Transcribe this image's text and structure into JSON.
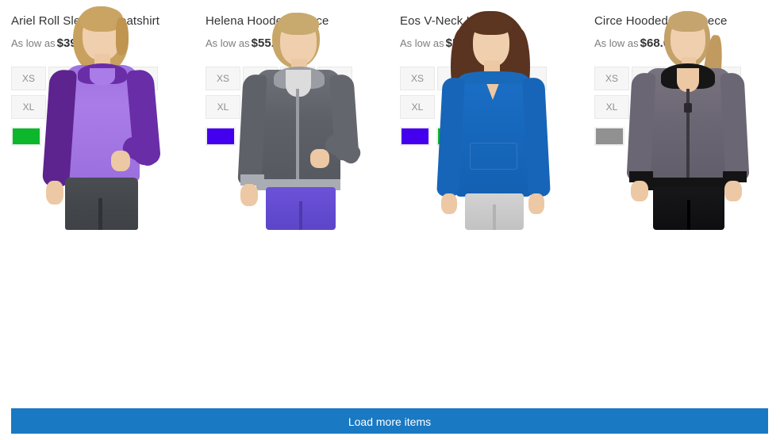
{
  "products": [
    {
      "name": "Ariel Roll Sleeve Sweatshirt",
      "price_prefix": "As low as",
      "price": "$39.00",
      "sizes": [
        "XS",
        "S",
        "M",
        "L",
        "XL"
      ],
      "colors": [
        {
          "name": "green-swatch",
          "hex": "#0CB72B"
        },
        {
          "name": "magenta-swatch",
          "hex": "#FF00FF"
        },
        {
          "name": "red-swatch",
          "hex": "#FF0000"
        }
      ],
      "image_alt": "Model wearing purple raglan hooded sweatshirt with gray shorts"
    },
    {
      "name": "Helena Hooded Fleece",
      "price_prefix": "As low as",
      "price": "$55.00",
      "sizes": [
        "XS",
        "S",
        "M",
        "L",
        "XL"
      ],
      "colors": [
        {
          "name": "blue-violet-swatch",
          "hex": "#4400EE"
        },
        {
          "name": "gray-swatch",
          "hex": "#919191"
        },
        {
          "name": "yellow-swatch",
          "hex": "#FFD800"
        }
      ],
      "image_alt": "Model wearing gray zip-up hooded fleece with purple leggings"
    },
    {
      "name": "Eos V-Neck Hoodie",
      "price_prefix": "As low as",
      "price": "$54.00",
      "sizes": [
        "XS",
        "S",
        "M",
        "L",
        "XL"
      ],
      "colors": [
        {
          "name": "blue-violet-swatch",
          "hex": "#4400EE"
        },
        {
          "name": "green-swatch",
          "hex": "#0CB72B"
        },
        {
          "name": "orange-swatch",
          "hex": "#FB6400"
        }
      ],
      "image_alt": "Model wearing blue V-neck hoodie with gray pants"
    },
    {
      "name": "Circe Hooded Ice Fleece",
      "price_prefix": "As low as",
      "price": "$68.00",
      "sizes": [
        "XS",
        "S",
        "M",
        "L",
        "XL"
      ],
      "colors": [
        {
          "name": "gray-swatch",
          "hex": "#919191"
        },
        {
          "name": "green-swatch",
          "hex": "#0CB72B"
        },
        {
          "name": "magenta-swatch",
          "hex": "#FF00FF"
        }
      ],
      "image_alt": "Model wearing gray hooded ice fleece with black trim and black pants"
    }
  ],
  "load_more": {
    "label": "Load more items",
    "color": "#1979c3"
  }
}
